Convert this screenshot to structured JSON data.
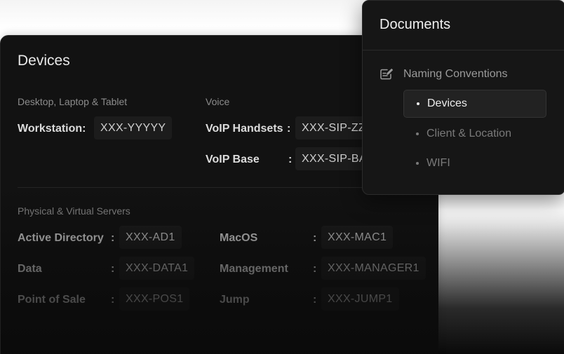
{
  "devices": {
    "title": "Devices",
    "sections": {
      "desktop": {
        "label": "Desktop, Laptop & Tablet",
        "rows": [
          {
            "label": "Workstation:",
            "value": "XXX-YYYYY"
          }
        ]
      },
      "voice": {
        "label": "Voice",
        "rows": [
          {
            "label": "VoIP Handsets",
            "colon": ":",
            "value": "XXX-SIP-ZZ"
          },
          {
            "label": "VoIP Base",
            "colon": ":",
            "value": "XXX-SIP-BA"
          }
        ]
      },
      "servers": {
        "label": "Physical & Virtual Servers",
        "left_rows": [
          {
            "label": "Active Directory",
            "colon": ":",
            "value": "XXX-AD1"
          },
          {
            "label": "Data",
            "colon": ":",
            "value": "XXX-DATA1"
          },
          {
            "label": "Point of Sale",
            "colon": ":",
            "value": "XXX-POS1"
          }
        ],
        "right_rows": [
          {
            "label": "MacOS",
            "colon": ":",
            "value": "XXX-MAC1"
          },
          {
            "label": "Management",
            "colon": ":",
            "value": "XXX-MANAGER1"
          },
          {
            "label": "Jump",
            "colon": ":",
            "value": "XXX-JUMP1"
          }
        ]
      }
    }
  },
  "documents": {
    "title": "Documents",
    "group": {
      "label": "Naming Conventions",
      "icon": "edit-document-icon"
    },
    "items": [
      {
        "label": "Devices",
        "active": true
      },
      {
        "label": "Client & Location",
        "active": false
      },
      {
        "label": "WIFI",
        "active": false
      }
    ]
  },
  "colors": {
    "panel_bg": "#121212",
    "chip_bg": "#1c1c1c",
    "active_item_bg": "#222222"
  }
}
